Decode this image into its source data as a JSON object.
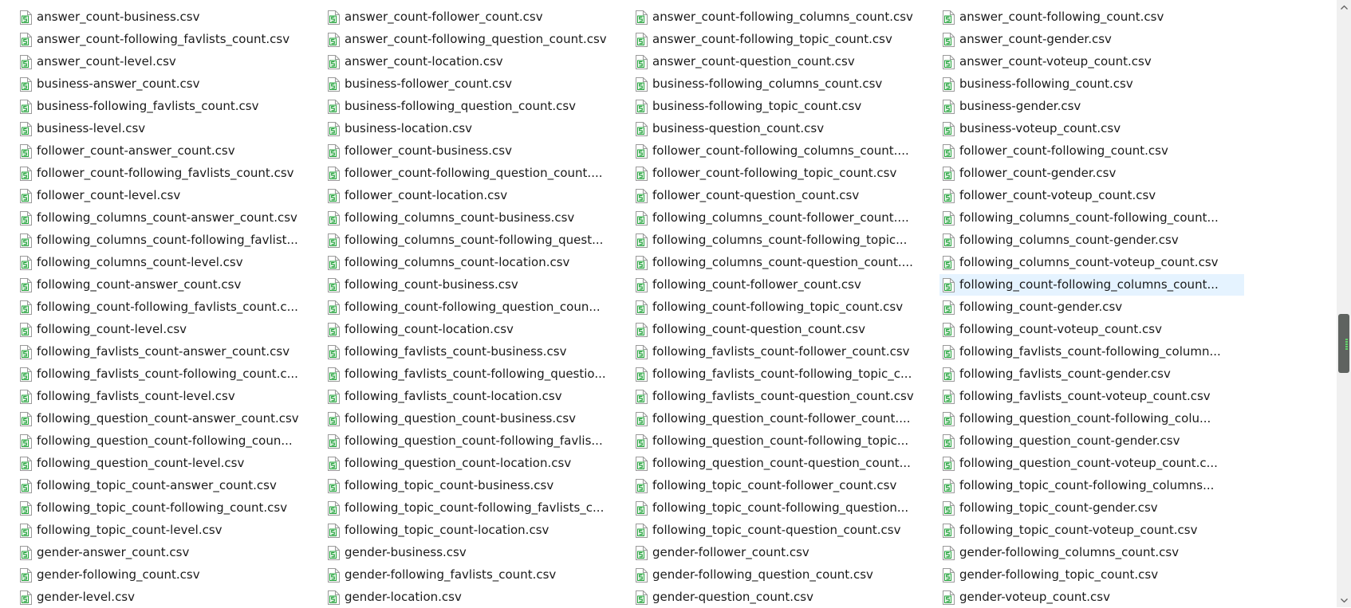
{
  "colors": {
    "selection": "#e5f3ff",
    "icon_green": "#22a23a",
    "scrollbar_thumb": "#5f6360"
  },
  "selected_index": 51,
  "files": [
    "answer_count-business.csv",
    "answer_count-follower_count.csv",
    "answer_count-following_columns_count.csv",
    "answer_count-following_count.csv",
    "answer_count-following_favlists_count.csv",
    "answer_count-following_question_count.csv",
    "answer_count-following_topic_count.csv",
    "answer_count-gender.csv",
    "answer_count-level.csv",
    "answer_count-location.csv",
    "answer_count-question_count.csv",
    "answer_count-voteup_count.csv",
    "business-answer_count.csv",
    "business-follower_count.csv",
    "business-following_columns_count.csv",
    "business-following_count.csv",
    "business-following_favlists_count.csv",
    "business-following_question_count.csv",
    "business-following_topic_count.csv",
    "business-gender.csv",
    "business-level.csv",
    "business-location.csv",
    "business-question_count.csv",
    "business-voteup_count.csv",
    "follower_count-answer_count.csv",
    "follower_count-business.csv",
    "follower_count-following_columns_count....",
    "follower_count-following_count.csv",
    "follower_count-following_favlists_count.csv",
    "follower_count-following_question_count....",
    "follower_count-following_topic_count.csv",
    "follower_count-gender.csv",
    "follower_count-level.csv",
    "follower_count-location.csv",
    "follower_count-question_count.csv",
    "follower_count-voteup_count.csv",
    "following_columns_count-answer_count.csv",
    "following_columns_count-business.csv",
    "following_columns_count-follower_count....",
    "following_columns_count-following_count...",
    "following_columns_count-following_favlist...",
    "following_columns_count-following_quest...",
    "following_columns_count-following_topic...",
    "following_columns_count-gender.csv",
    "following_columns_count-level.csv",
    "following_columns_count-location.csv",
    "following_columns_count-question_count....",
    "following_columns_count-voteup_count.csv",
    "following_count-answer_count.csv",
    "following_count-business.csv",
    "following_count-follower_count.csv",
    "following_count-following_columns_count...",
    "following_count-following_favlists_count.c...",
    "following_count-following_question_coun...",
    "following_count-following_topic_count.csv",
    "following_count-gender.csv",
    "following_count-level.csv",
    "following_count-location.csv",
    "following_count-question_count.csv",
    "following_count-voteup_count.csv",
    "following_favlists_count-answer_count.csv",
    "following_favlists_count-business.csv",
    "following_favlists_count-follower_count.csv",
    "following_favlists_count-following_column...",
    "following_favlists_count-following_count.c...",
    "following_favlists_count-following_questio...",
    "following_favlists_count-following_topic_c...",
    "following_favlists_count-gender.csv",
    "following_favlists_count-level.csv",
    "following_favlists_count-location.csv",
    "following_favlists_count-question_count.csv",
    "following_favlists_count-voteup_count.csv",
    "following_question_count-answer_count.csv",
    "following_question_count-business.csv",
    "following_question_count-follower_count....",
    "following_question_count-following_colu...",
    "following_question_count-following_coun...",
    "following_question_count-following_favlis...",
    "following_question_count-following_topic...",
    "following_question_count-gender.csv",
    "following_question_count-level.csv",
    "following_question_count-location.csv",
    "following_question_count-question_count...",
    "following_question_count-voteup_count.c...",
    "following_topic_count-answer_count.csv",
    "following_topic_count-business.csv",
    "following_topic_count-follower_count.csv",
    "following_topic_count-following_columns...",
    "following_topic_count-following_count.csv",
    "following_topic_count-following_favlists_c...",
    "following_topic_count-following_question...",
    "following_topic_count-gender.csv",
    "following_topic_count-level.csv",
    "following_topic_count-location.csv",
    "following_topic_count-question_count.csv",
    "following_topic_count-voteup_count.csv",
    "gender-answer_count.csv",
    "gender-business.csv",
    "gender-follower_count.csv",
    "gender-following_columns_count.csv",
    "gender-following_count.csv",
    "gender-following_favlists_count.csv",
    "gender-following_question_count.csv",
    "gender-following_topic_count.csv",
    "gender-level.csv",
    "gender-location.csv",
    "gender-question_count.csv",
    "gender-voteup_count.csv"
  ]
}
